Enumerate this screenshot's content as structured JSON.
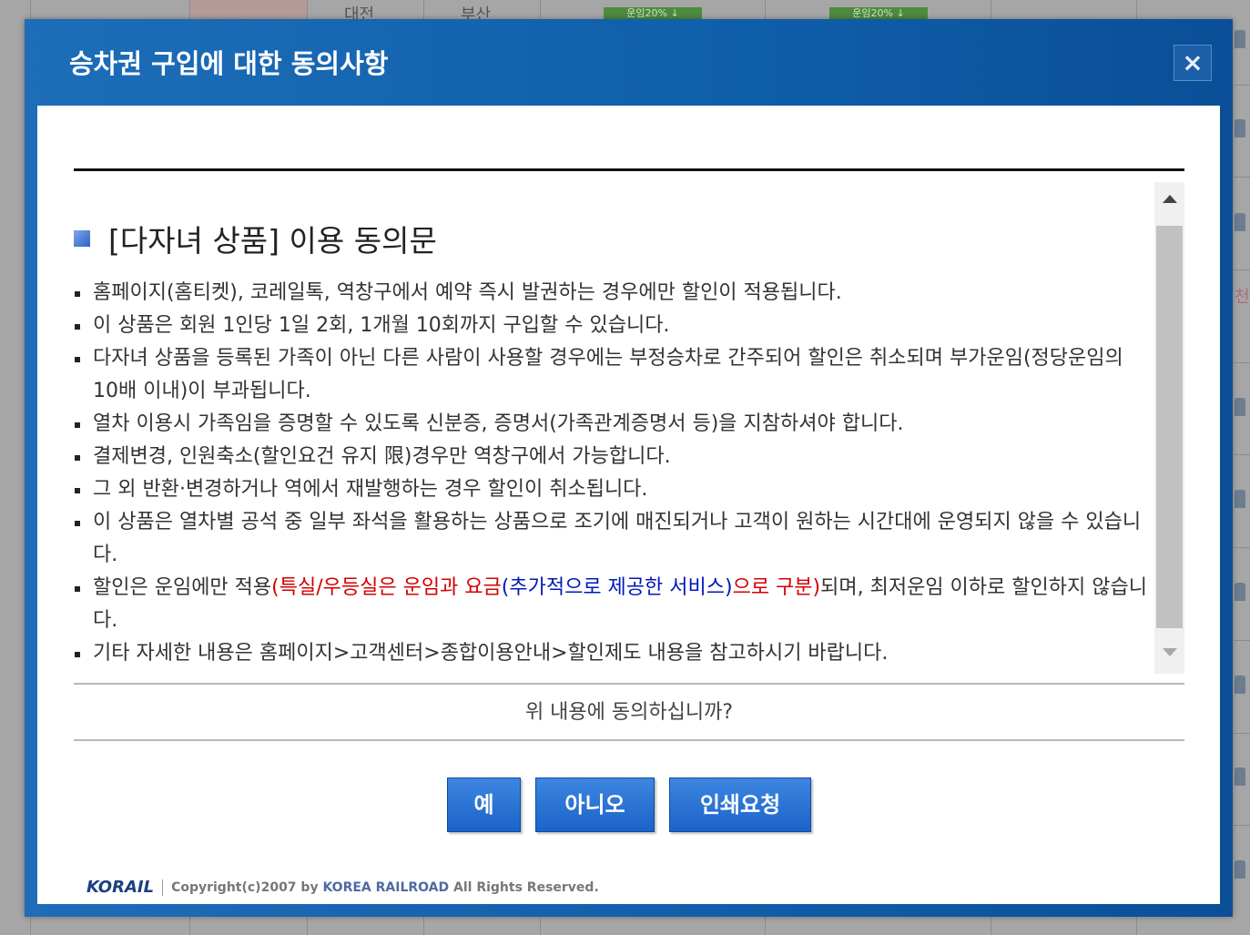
{
  "background": {
    "cells": [
      "대전",
      "부산"
    ],
    "badges": [
      "운임20% ↓",
      "운임20% ↓"
    ],
    "side_text": "천"
  },
  "modal": {
    "title": "승차권 구입에 대한 동의사항",
    "close_label": "×",
    "section_title": "[다자녀 상품] 이용 동의문",
    "terms": [
      "홈페이지(홈티켓), 코레일톡, 역창구에서 예약 즉시 발권하는 경우에만 할인이 적용됩니다.",
      "이 상품은 회원 1인당 1일 2회, 1개월 10회까지 구입할 수 있습니다.",
      "다자녀 상품을 등록된 가족이 아닌 다른 사람이 사용할 경우에는 부정승차로 간주되어 할인은 취소되며 부가운임(정당운임의 10배 이내)이 부과됩니다.",
      "열차 이용시 가족임을 증명할 수 있도록 신분증, 증명서(가족관계증명서 등)을 지참하셔야 합니다.",
      "결제변경, 인원축소(할인요건 유지 限)경우만 역창구에서 가능합니다.",
      "그 외 반환·변경하거나 역에서 재발행하는 경우 할인이 취소됩니다.",
      "이 상품은 열차별 공석 중 일부 좌석을 활용하는 상품으로 조기에 매진되거나 고객이 원하는 시간대에 운영되지 않을 수 있습니다."
    ],
    "fare_term": {
      "part1": "할인은 운임에만 적용",
      "part2": "(특실/우등실은 운임과 요금",
      "part3": "(추가적으로 제공한 서비스)",
      "part4": "으로 구분)",
      "part5": "되며, 최저운임 이하로 할인하지 않습니다."
    },
    "last_term": "기타 자세한 내용은 홈페이지>고객센터>종합이용안내>할인제도 내용을 참고하시기 바랍니다.",
    "question": "위 내용에 동의하십니까?",
    "buttons": {
      "yes": "예",
      "no": "아니오",
      "print": "인쇄요청"
    },
    "footer": {
      "logo": "KORAIL",
      "copyright_prefix": "Copyright(c)2007 by ",
      "brand": "KOREA RAILROAD",
      "copyright_suffix": " All Rights Reserved."
    }
  },
  "colors": {
    "modal_blue": "#0f5ea9",
    "button_blue": "#1b63c9",
    "highlight_red": "#d40000",
    "highlight_blue": "#0018b8"
  }
}
